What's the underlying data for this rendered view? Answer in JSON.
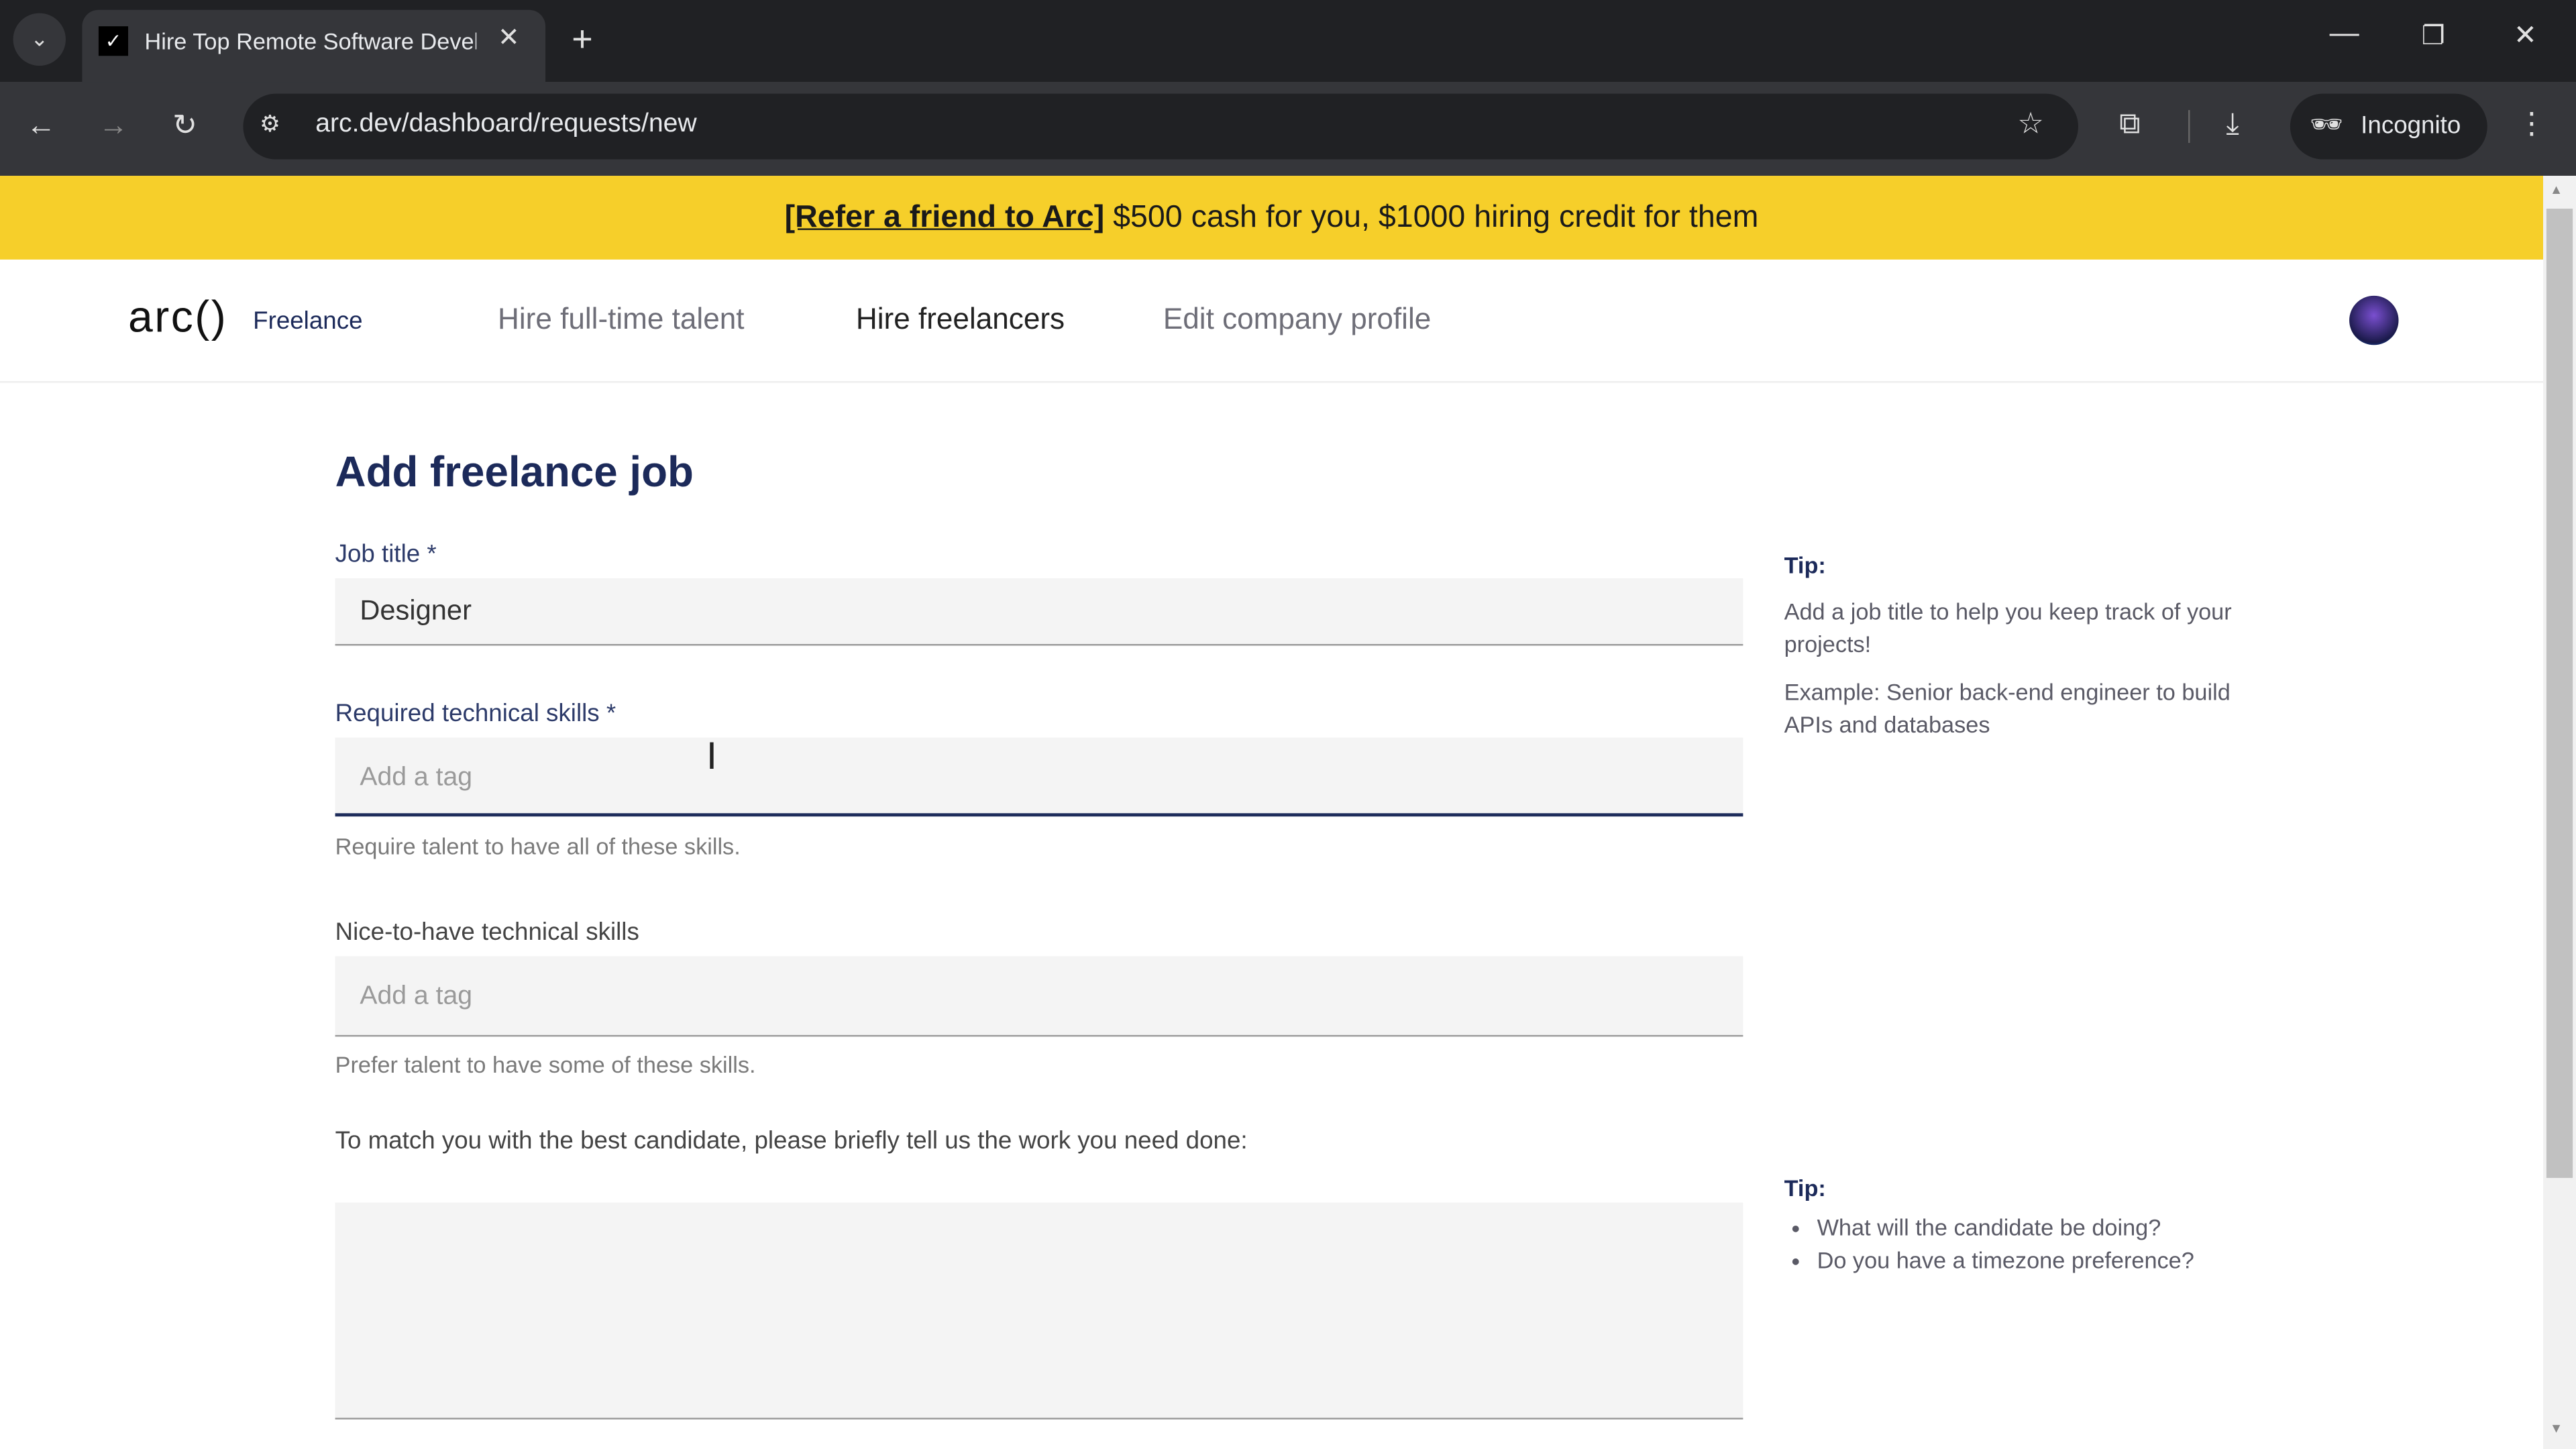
{
  "browser": {
    "tab_title": "Hire Top Remote Software Developers",
    "url": "arc.dev/dashboard/requests/new",
    "profile_label": "Incognito"
  },
  "banner": {
    "link": "[Refer a friend to Arc]",
    "text": " $500 cash for you, $1000 hiring credit for them"
  },
  "nav": {
    "logo": "arc()",
    "logo_sub": "Freelance",
    "items": [
      "Hire full-time talent",
      "Hire freelancers",
      "Edit company profile"
    ]
  },
  "form": {
    "title": "Add freelance job",
    "job_title_label": "Job title *",
    "job_title_value": "Designer",
    "required_label": "Required technical skills *",
    "required_placeholder": "Add a tag",
    "required_help": "Require talent to have all of these skills.",
    "nice_label": "Nice-to-have technical skills",
    "nice_placeholder": "Add a tag",
    "nice_help": "Prefer talent to have some of these skills.",
    "description_label": "To match you with the best candidate, please briefly tell us the work you need done:"
  },
  "tips": [
    {
      "heading": "Tip:",
      "lines": [
        "Add a job title to help you keep track of your projects!",
        "Example: Senior back-end engineer to build APIs and databases"
      ]
    },
    {
      "heading": "Tip:",
      "bullets": [
        "What will the candidate be doing?",
        "Do you have a timezone preference?"
      ]
    }
  ],
  "colors": {
    "banner": "#f6cf2a",
    "heading": "#1c2a5a",
    "focus": "#1f2d5c"
  }
}
